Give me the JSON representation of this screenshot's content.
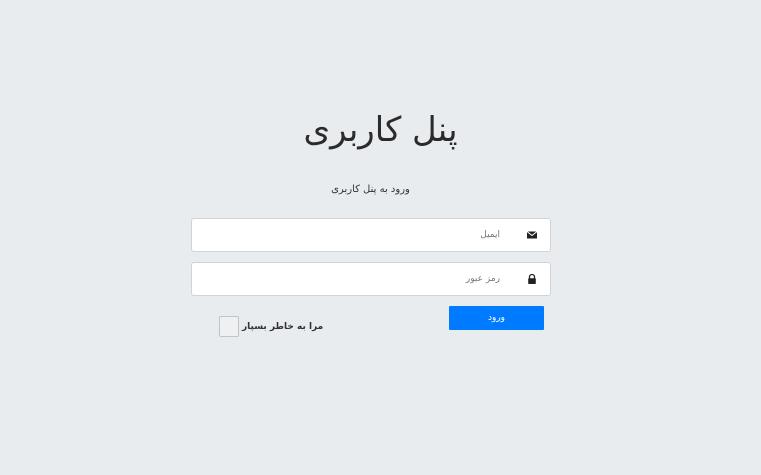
{
  "page": {
    "title": "پنل کاربری",
    "subtitle": "ورود به پنل کاربری"
  },
  "form": {
    "email": {
      "placeholder": "ایمیل",
      "value": "",
      "icon": "envelope-icon"
    },
    "password": {
      "placeholder": "رمز عبور",
      "value": "",
      "icon": "lock-icon"
    },
    "login_label": "ورود",
    "remember_label": "مرا به خاطر بسپار",
    "remember_checked": false
  },
  "colors": {
    "background": "#e9ecef",
    "primary": "#007bff",
    "field_border": "#ced4da"
  }
}
